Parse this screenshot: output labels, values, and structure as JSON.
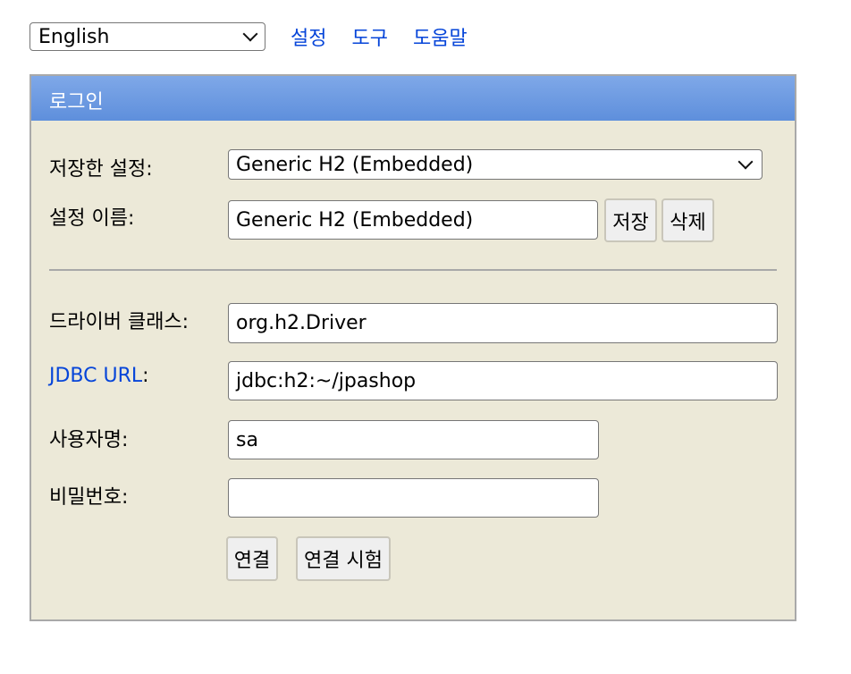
{
  "topbar": {
    "language": "English",
    "links": [
      "설정",
      "도구",
      "도움말"
    ]
  },
  "panel": {
    "title": "로그인",
    "saved_settings_label": "저장한 설정:",
    "saved_settings_value": "Generic H2 (Embedded)",
    "setting_name_label": "설정 이름:",
    "setting_name_value": "Generic H2 (Embedded)",
    "save_button": "저장",
    "delete_button": "삭제",
    "driver_class_label": "드라이버 클래스:",
    "driver_class_value": "org.h2.Driver",
    "jdbc_url_label": "JDBC URL",
    "jdbc_url_colon": ":",
    "jdbc_url_value": "jdbc:h2:~/jpashop",
    "username_label": "사용자명:",
    "username_value": "sa",
    "password_label": "비밀번호:",
    "password_value": "",
    "connect_button": "연결",
    "test_connection_button": "연결 시험"
  },
  "colors": {
    "link": "#0645d9",
    "header_gradient_top": "#7fa8e8",
    "header_gradient_bottom": "#5e8fdc",
    "panel_bg": "#ece9d8"
  }
}
